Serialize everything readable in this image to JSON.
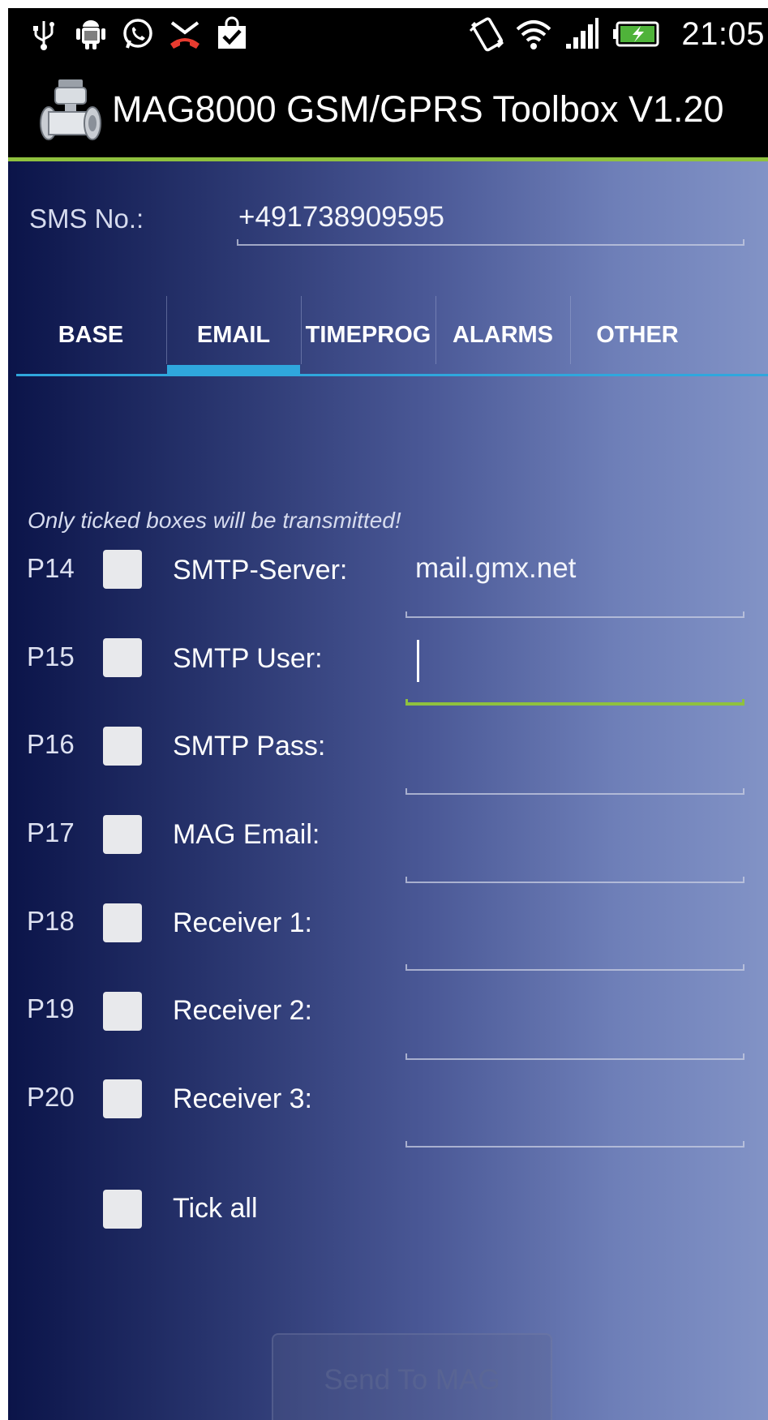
{
  "status_bar": {
    "icons": [
      "usb-icon",
      "android-debug-icon",
      "whatsapp-icon",
      "missed-call-icon",
      "shopping-bag-check-icon",
      "vibrate-icon",
      "wifi-icon",
      "signal-icon",
      "battery-charging-icon"
    ],
    "time": "21:05"
  },
  "action_bar": {
    "title": "MAG8000 GSM/GPRS Toolbox V1.20",
    "accent_color": "#8fc13e"
  },
  "sms": {
    "label": "SMS No.:",
    "value": "+491738909595"
  },
  "tabs": [
    {
      "label": "BASE",
      "selected": false
    },
    {
      "label": "EMAIL",
      "selected": true
    },
    {
      "label": "TIMEPROG",
      "selected": false
    },
    {
      "label": "ALARMS",
      "selected": false
    },
    {
      "label": "OTHER",
      "selected": false
    }
  ],
  "tab_indicator_color": "#2fa7dd",
  "hint": "Only ticked boxes will be transmitted!",
  "fields": [
    {
      "param": "P14",
      "label": "SMTP-Server:",
      "value": "mail.gmx.net",
      "checked": false
    },
    {
      "param": "P15",
      "label": "SMTP User:",
      "value": "",
      "checked": false,
      "focused": true
    },
    {
      "param": "P16",
      "label": "SMTP Pass:",
      "value": "",
      "checked": false
    },
    {
      "param": "P17",
      "label": "MAG Email:",
      "value": "",
      "checked": false
    },
    {
      "param": "P18",
      "label": "Receiver 1:",
      "value": "",
      "checked": false
    },
    {
      "param": "P19",
      "label": "Receiver 2:",
      "value": "",
      "checked": false
    },
    {
      "param": "P20",
      "label": "Receiver 3:",
      "value": "",
      "checked": false
    }
  ],
  "tick_all": {
    "label": "Tick all",
    "checked": false
  },
  "send_button": {
    "label": "Send To MAG",
    "enabled": false
  }
}
